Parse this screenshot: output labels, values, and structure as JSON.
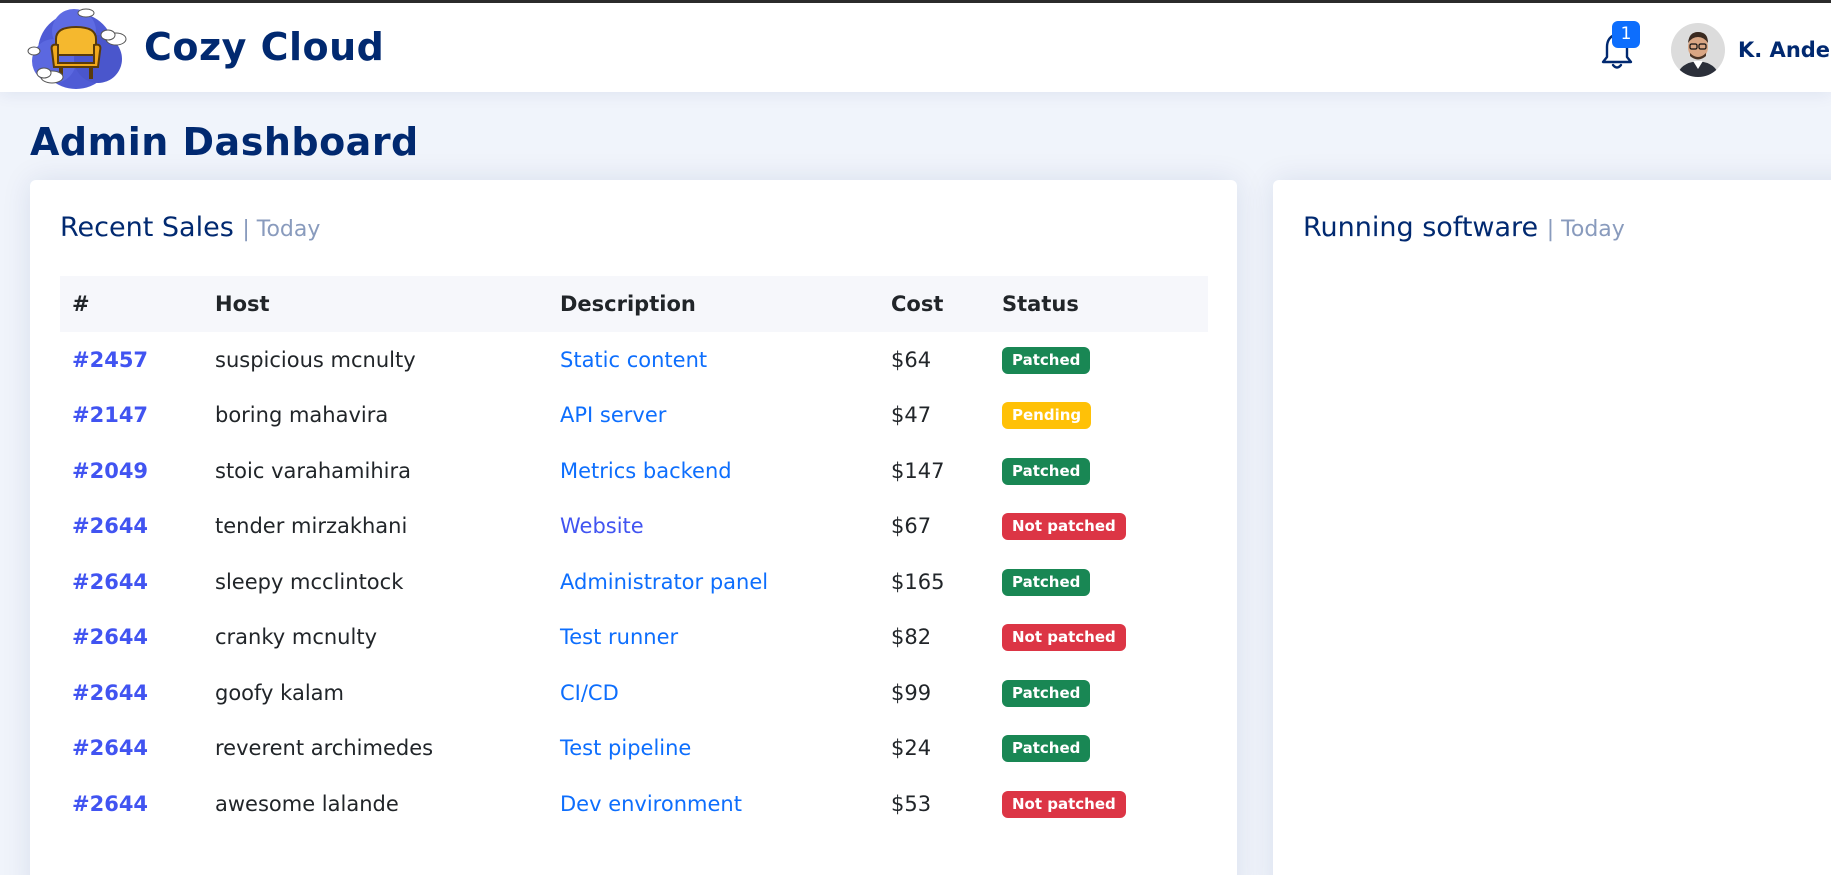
{
  "header": {
    "brand": "Cozy Cloud",
    "notification_count": "1",
    "user_name": "K. Anderson"
  },
  "page": {
    "title": "Admin Dashboard"
  },
  "sales_card": {
    "title": "Recent Sales",
    "subtitle": "| Today",
    "columns": [
      "#",
      "Host",
      "Description",
      "Cost",
      "Status"
    ],
    "rows": [
      {
        "id": "#2457",
        "host": "suspicious mcnulty",
        "description": "Static content",
        "cost": "$64",
        "status": "Patched",
        "status_type": "success"
      },
      {
        "id": "#2147",
        "host": "boring mahavira",
        "description": "API server",
        "cost": "$47",
        "status": "Pending",
        "status_type": "warning"
      },
      {
        "id": "#2049",
        "host": "stoic varahamihira",
        "description": "Metrics backend",
        "cost": "$147",
        "status": "Patched",
        "status_type": "success"
      },
      {
        "id": "#2644",
        "host": "tender mirzakhani",
        "description": "Website",
        "cost": "$67",
        "status": "Not patched",
        "status_type": "danger"
      },
      {
        "id": "#2644",
        "host": "sleepy mcclintock",
        "description": "Administrator panel",
        "cost": "$165",
        "status": "Patched",
        "status_type": "success"
      },
      {
        "id": "#2644",
        "host": "cranky mcnulty",
        "description": "Test runner",
        "cost": "$82",
        "status": "Not patched",
        "status_type": "danger"
      },
      {
        "id": "#2644",
        "host": "goofy kalam",
        "description": "CI/CD",
        "cost": "$99",
        "status": "Patched",
        "status_type": "success"
      },
      {
        "id": "#2644",
        "host": "reverent archimedes",
        "description": "Test pipeline",
        "cost": "$24",
        "status": "Patched",
        "status_type": "success"
      },
      {
        "id": "#2644",
        "host": "awesome lalande",
        "description": "Dev environment",
        "cost": "$53",
        "status": "Not patched",
        "status_type": "danger"
      }
    ]
  },
  "software_card": {
    "title": "Running software",
    "subtitle": "| Today"
  },
  "colors": {
    "brand_navy": "#012970",
    "link_blue": "#0d6efd",
    "id_blue": "#4154f1",
    "success": "#198754",
    "warning": "#ffc107",
    "danger": "#dc3545"
  },
  "icons": {
    "logo": "cozy-cloud-chair-logo",
    "notification": "bell-icon",
    "avatar": "user-avatar"
  }
}
